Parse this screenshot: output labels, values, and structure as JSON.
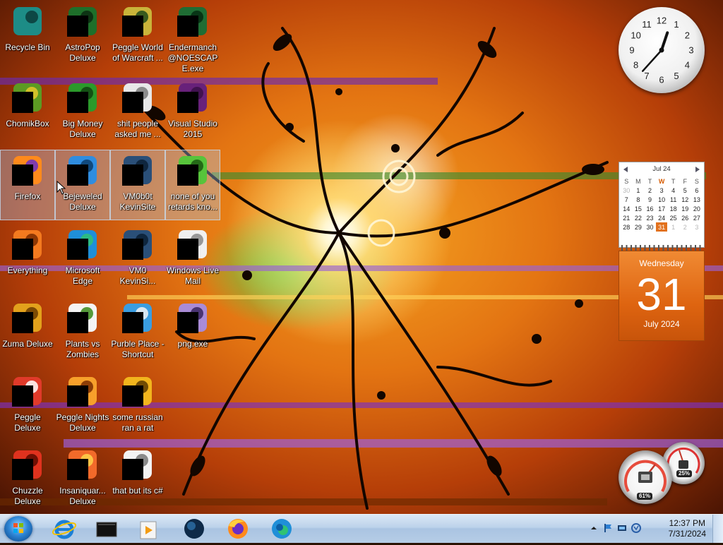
{
  "desktop": {
    "icons": [
      {
        "col": 0,
        "row": 0,
        "label": "Recycle Bin",
        "icon": "recycle-bin-icon"
      },
      {
        "col": 1,
        "row": 0,
        "label": "AstroPop Deluxe",
        "icon": "astropop-icon"
      },
      {
        "col": 2,
        "row": 0,
        "label": "Peggle World of Warcraft ...",
        "icon": "peggle-wow-icon"
      },
      {
        "col": 3,
        "row": 0,
        "label": "Endermanch @NOESCAPE.exe",
        "icon": "endermanch-icon"
      },
      {
        "col": 0,
        "row": 1,
        "label": "ChomikBox",
        "icon": "chomikbox-icon"
      },
      {
        "col": 1,
        "row": 1,
        "label": "Big Money Deluxe",
        "icon": "big-money-icon"
      },
      {
        "col": 2,
        "row": 1,
        "label": "shit people asked me ...",
        "icon": "text-file-icon"
      },
      {
        "col": 3,
        "row": 1,
        "label": "Visual Studio 2015",
        "icon": "visual-studio-icon"
      },
      {
        "col": 0,
        "row": 2,
        "label": "Firefox",
        "icon": "firefox-icon",
        "selected": true
      },
      {
        "col": 1,
        "row": 2,
        "label": "Bejeweled Deluxe",
        "icon": "bejeweled-icon",
        "selected": true
      },
      {
        "col": 2,
        "row": 2,
        "label": "VM0b0t KevinSite",
        "icon": "vm-folder-icon",
        "selected": true
      },
      {
        "col": 3,
        "row": 2,
        "label": "none of you retards kno...",
        "icon": "generic-file-icon",
        "selected": true
      },
      {
        "col": 0,
        "row": 3,
        "label": "Everything",
        "icon": "everything-search-icon"
      },
      {
        "col": 1,
        "row": 3,
        "label": "Microsoft Edge",
        "icon": "edge-icon"
      },
      {
        "col": 2,
        "row": 3,
        "label": "VM0 KevinSi...",
        "icon": "vm-folder-icon"
      },
      {
        "col": 3,
        "row": 3,
        "label": "Windows Live Mail",
        "icon": "windows-live-mail-icon"
      },
      {
        "col": 0,
        "row": 4,
        "label": "Zuma Deluxe",
        "icon": "zuma-icon"
      },
      {
        "col": 1,
        "row": 4,
        "label": "Plants vs Zombies",
        "icon": "plants-vs-zombies-icon"
      },
      {
        "col": 2,
        "row": 4,
        "label": "Purble Place - Shortcut",
        "icon": "purble-place-icon"
      },
      {
        "col": 3,
        "row": 4,
        "label": "png.exe",
        "icon": "png-exe-icon"
      },
      {
        "col": 0,
        "row": 5,
        "label": "Peggle Deluxe",
        "icon": "peggle-icon"
      },
      {
        "col": 1,
        "row": 5,
        "label": "Peggle Nights Deluxe",
        "icon": "peggle-nights-icon"
      },
      {
        "col": 2,
        "row": 5,
        "label": "some russian ran a rat",
        "icon": "rat-file-icon"
      },
      {
        "col": 0,
        "row": 6,
        "label": "Chuzzle Deluxe",
        "icon": "chuzzle-icon"
      },
      {
        "col": 1,
        "row": 6,
        "label": "Insaniquar... Deluxe",
        "icon": "insaniquarium-icon"
      },
      {
        "col": 2,
        "row": 6,
        "label": "that but its c#",
        "icon": "copy-file-icon"
      }
    ]
  },
  "gadgets": {
    "clock": {
      "hour": 12,
      "minute": 37
    },
    "calendar": {
      "month_label": "Jul 24",
      "dow": [
        "S",
        "M",
        "T",
        "W",
        "T",
        "F",
        "S"
      ],
      "weeks": [
        [
          "30",
          "1",
          "2",
          "3",
          "4",
          "5",
          "6"
        ],
        [
          "7",
          "8",
          "9",
          "10",
          "11",
          "12",
          "13"
        ],
        [
          "14",
          "15",
          "16",
          "17",
          "18",
          "19",
          "20"
        ],
        [
          "21",
          "22",
          "23",
          "24",
          "25",
          "26",
          "27"
        ],
        [
          "28",
          "29",
          "30",
          "31",
          "1",
          "2",
          "3"
        ]
      ],
      "day_name": "Wednesday",
      "day_number": "31",
      "month_year": "July 2024"
    },
    "cpu_meter": {
      "cpu_percent": "61%",
      "memory_percent": "25%"
    }
  },
  "taskbar": {
    "pinned": [
      "internet-explorer-icon",
      "terminal-icon",
      "media-player-icon",
      "globe-icon",
      "firefox-icon",
      "edge-icon"
    ],
    "time": "12:37 PM",
    "date": "7/31/2024"
  },
  "colors": {
    "wallpaper_orange": "#e37412",
    "selection": "#aad2ff",
    "calendar_accent": "#de6410",
    "taskbar": "#bcd2ea"
  }
}
